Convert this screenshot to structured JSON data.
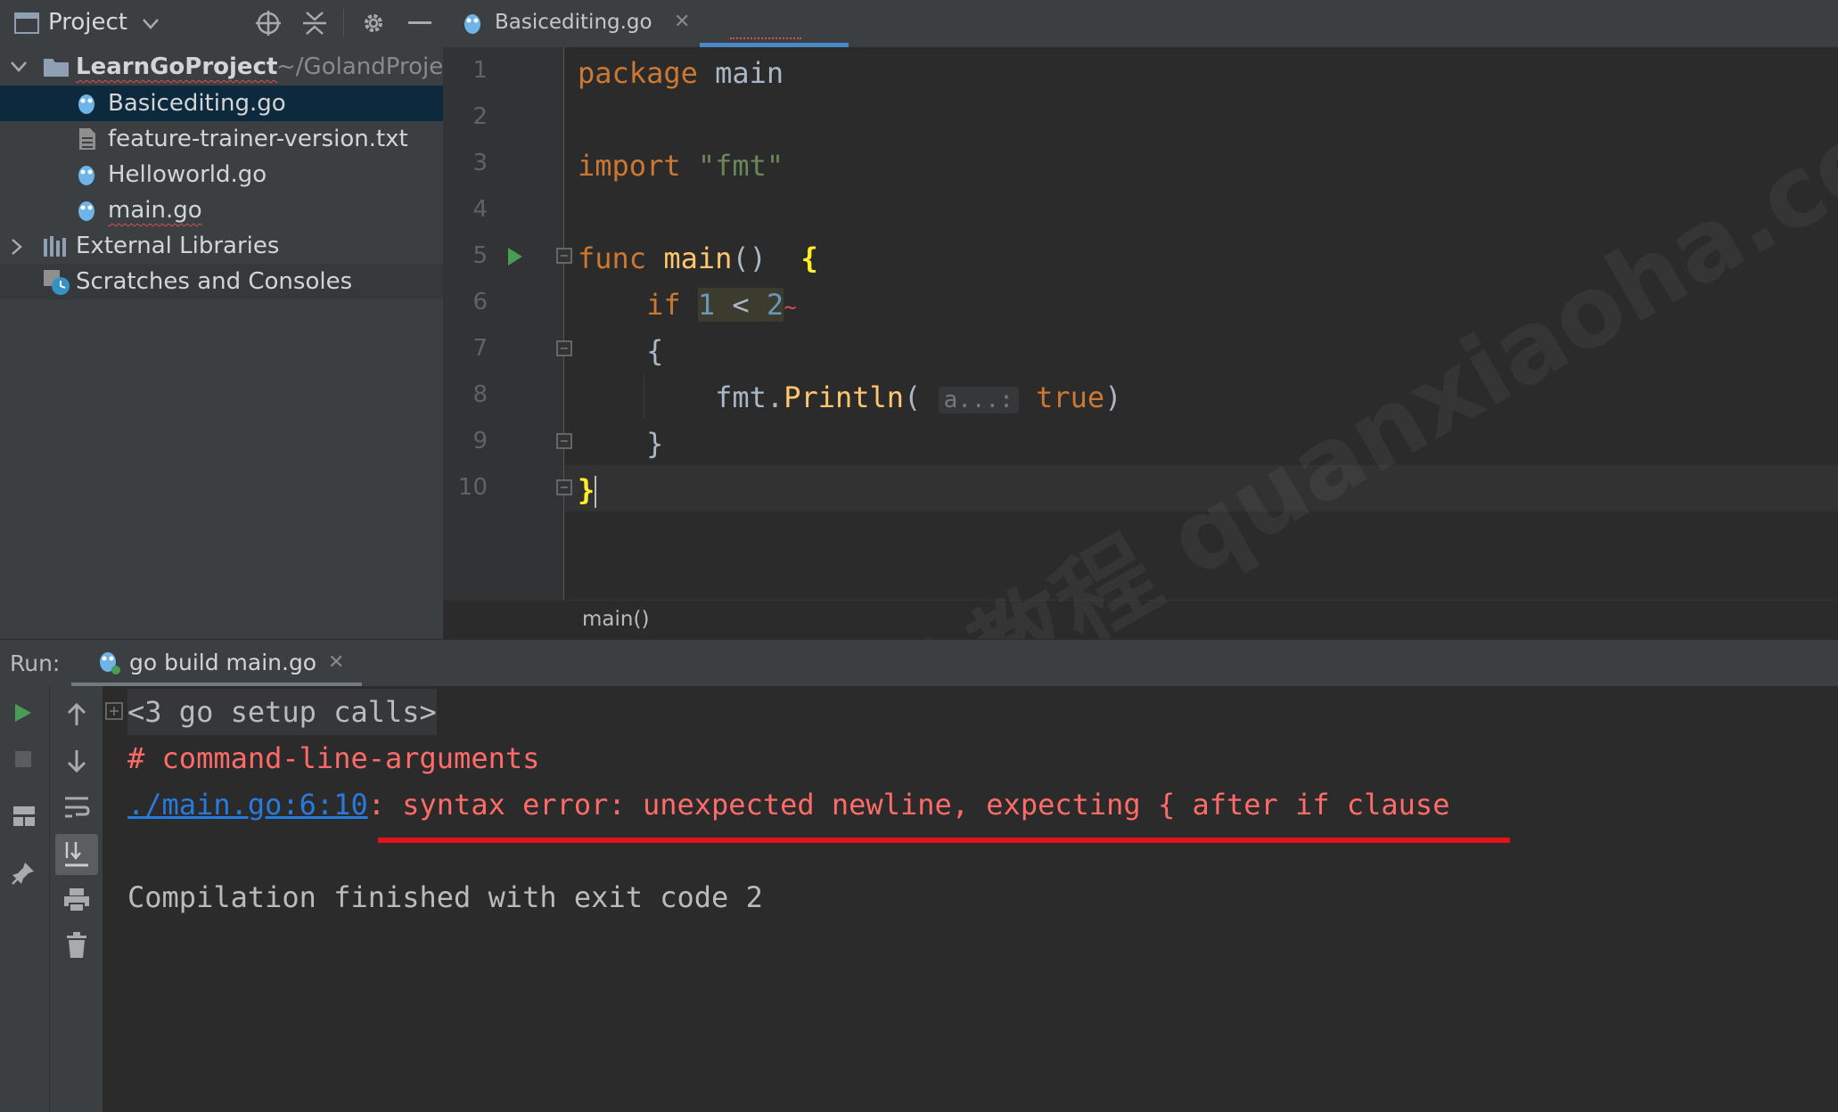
{
  "project": {
    "title": "Project",
    "root_name": "LearnGoProject",
    "root_path": "~/GolandProjec",
    "files": [
      "Basicediting.go",
      "feature-trainer-version.txt",
      "Helloworld.go",
      "main.go"
    ],
    "external_libraries": "External Libraries",
    "scratches": "Scratches and Consoles"
  },
  "editor": {
    "active_tab": "Basicediting.go",
    "line_numbers": [
      "1",
      "2",
      "3",
      "4",
      "5",
      "6",
      "7",
      "8",
      "9",
      "10"
    ],
    "code": {
      "l1_kw": "package",
      "l1_name": "main",
      "l3_kw": "import",
      "l3_str": "\"fmt\"",
      "l5_kw": "func",
      "l5_fn": "main",
      "l5_paren": "()",
      "l5_brace": "{",
      "l6_kw": "if",
      "l6_a": "1",
      "l6_op": "<",
      "l6_b": "2",
      "l7_brace": "{",
      "l8_pkg": "fmt.",
      "l8_fn": "Println",
      "l8_open": "(",
      "l8_hint": "a...:",
      "l8_val": "true",
      "l8_close": ")",
      "l9_brace": "}",
      "l10_brace": "}"
    },
    "breadcrumb": "main()"
  },
  "run": {
    "label": "Run:",
    "tab": "go build main.go",
    "console": {
      "setup": "<3 go setup calls>",
      "header": "# command-line-arguments",
      "link": "./main.go:6:10",
      "error": ": syntax error: unexpected newline, expecting { after if clause",
      "finish": "Compilation finished with exit code 2"
    }
  },
  "watermark": "大小哈教程 quanxiaoha.com",
  "colors": {
    "accent": "#4a88c7",
    "error": "#ff6b68",
    "annotation": "#e0121a",
    "run_green": "#499c54"
  }
}
